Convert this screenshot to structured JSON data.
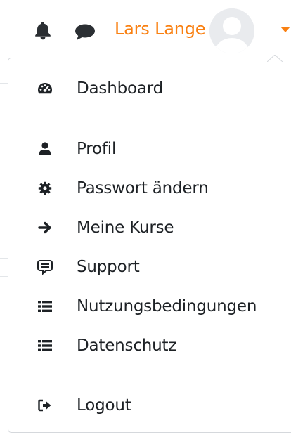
{
  "header": {
    "user_name": "Lars Lange",
    "accent_color": "#f98012",
    "icons": [
      "bell-icon",
      "chat-icon",
      "avatar-placeholder",
      "caret-down-icon"
    ]
  },
  "user_menu": {
    "groups": [
      [
        {
          "label": "Dashboard",
          "icon": "dashboard-icon"
        }
      ],
      [
        {
          "label": "Profil",
          "icon": "user-icon"
        },
        {
          "label": "Passwort ändern",
          "icon": "gear-icon"
        },
        {
          "label": "Meine Kurse",
          "icon": "arrow-right-icon"
        },
        {
          "label": "Support",
          "icon": "support-chat-icon"
        },
        {
          "label": "Nutzungsbedingungen",
          "icon": "list-icon"
        },
        {
          "label": "Datenschutz",
          "icon": "list-icon"
        }
      ],
      [
        {
          "label": "Logout",
          "icon": "sign-out-icon"
        }
      ]
    ]
  }
}
